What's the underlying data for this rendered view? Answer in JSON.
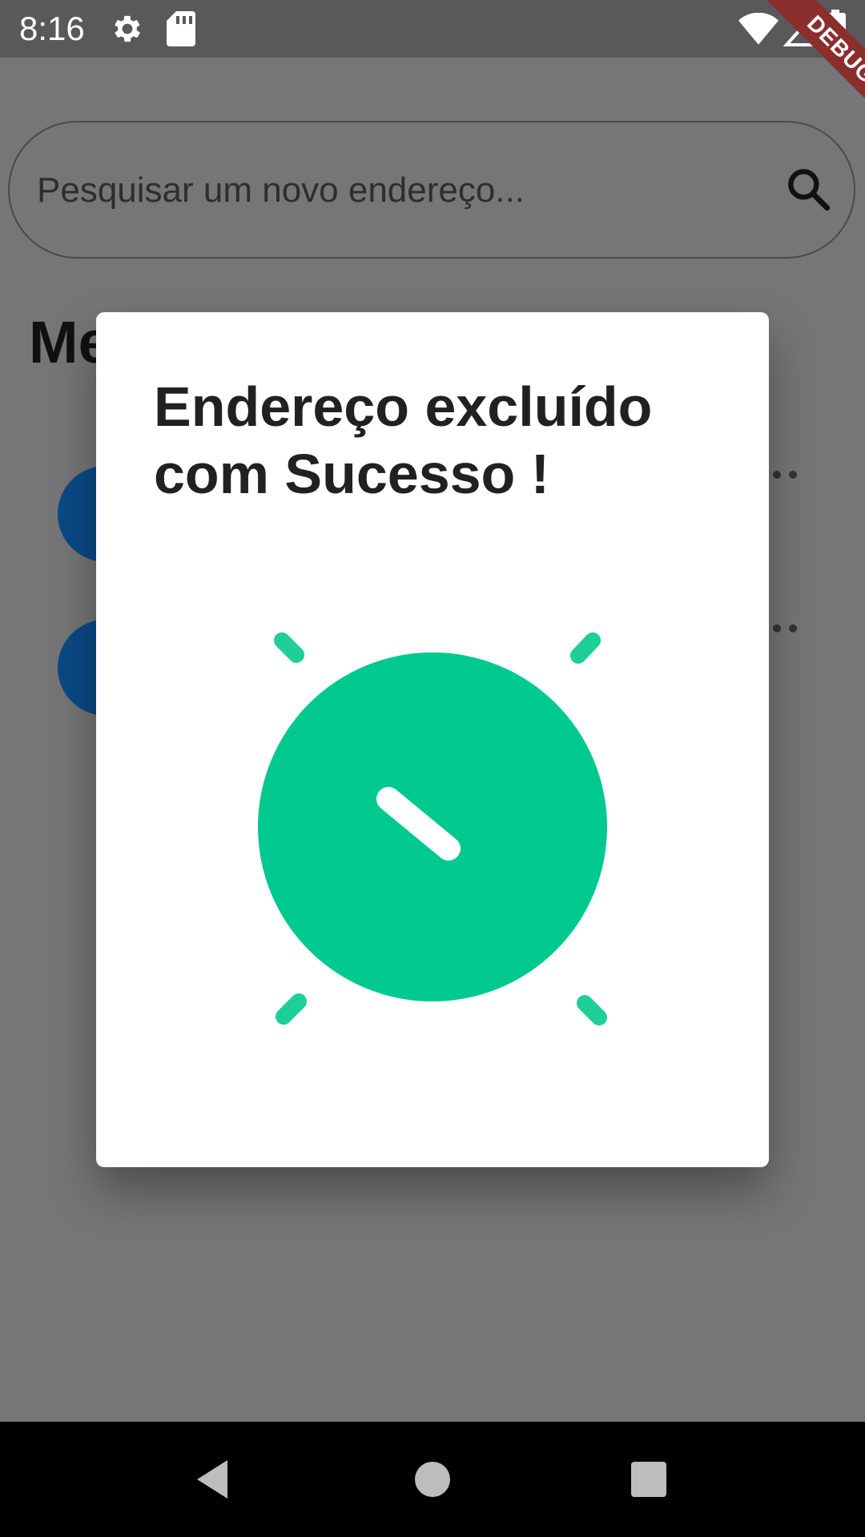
{
  "status_bar": {
    "time": "8:16",
    "icons": [
      "gear-icon",
      "sd-card-icon",
      "wifi-icon",
      "signal-icon",
      "battery-icon"
    ]
  },
  "debug_banner": "DEBUG",
  "search": {
    "placeholder": "Pesquisar um novo endereço...",
    "icon": "search-icon"
  },
  "background": {
    "section_heading_visible": "Me"
  },
  "dialog": {
    "title": "Endereço excluído com Sucesso !",
    "graphic": "success-check-icon",
    "accent_color": "#00C98F"
  },
  "nav_bar": {
    "buttons": [
      "back-icon",
      "home-icon",
      "recents-icon"
    ]
  },
  "colors": {
    "scrim": "#767676",
    "status_bar": "#595959",
    "avatar": "#0A4A86",
    "success": "#00C98F",
    "debug_ribbon": "#8A2E2E"
  }
}
